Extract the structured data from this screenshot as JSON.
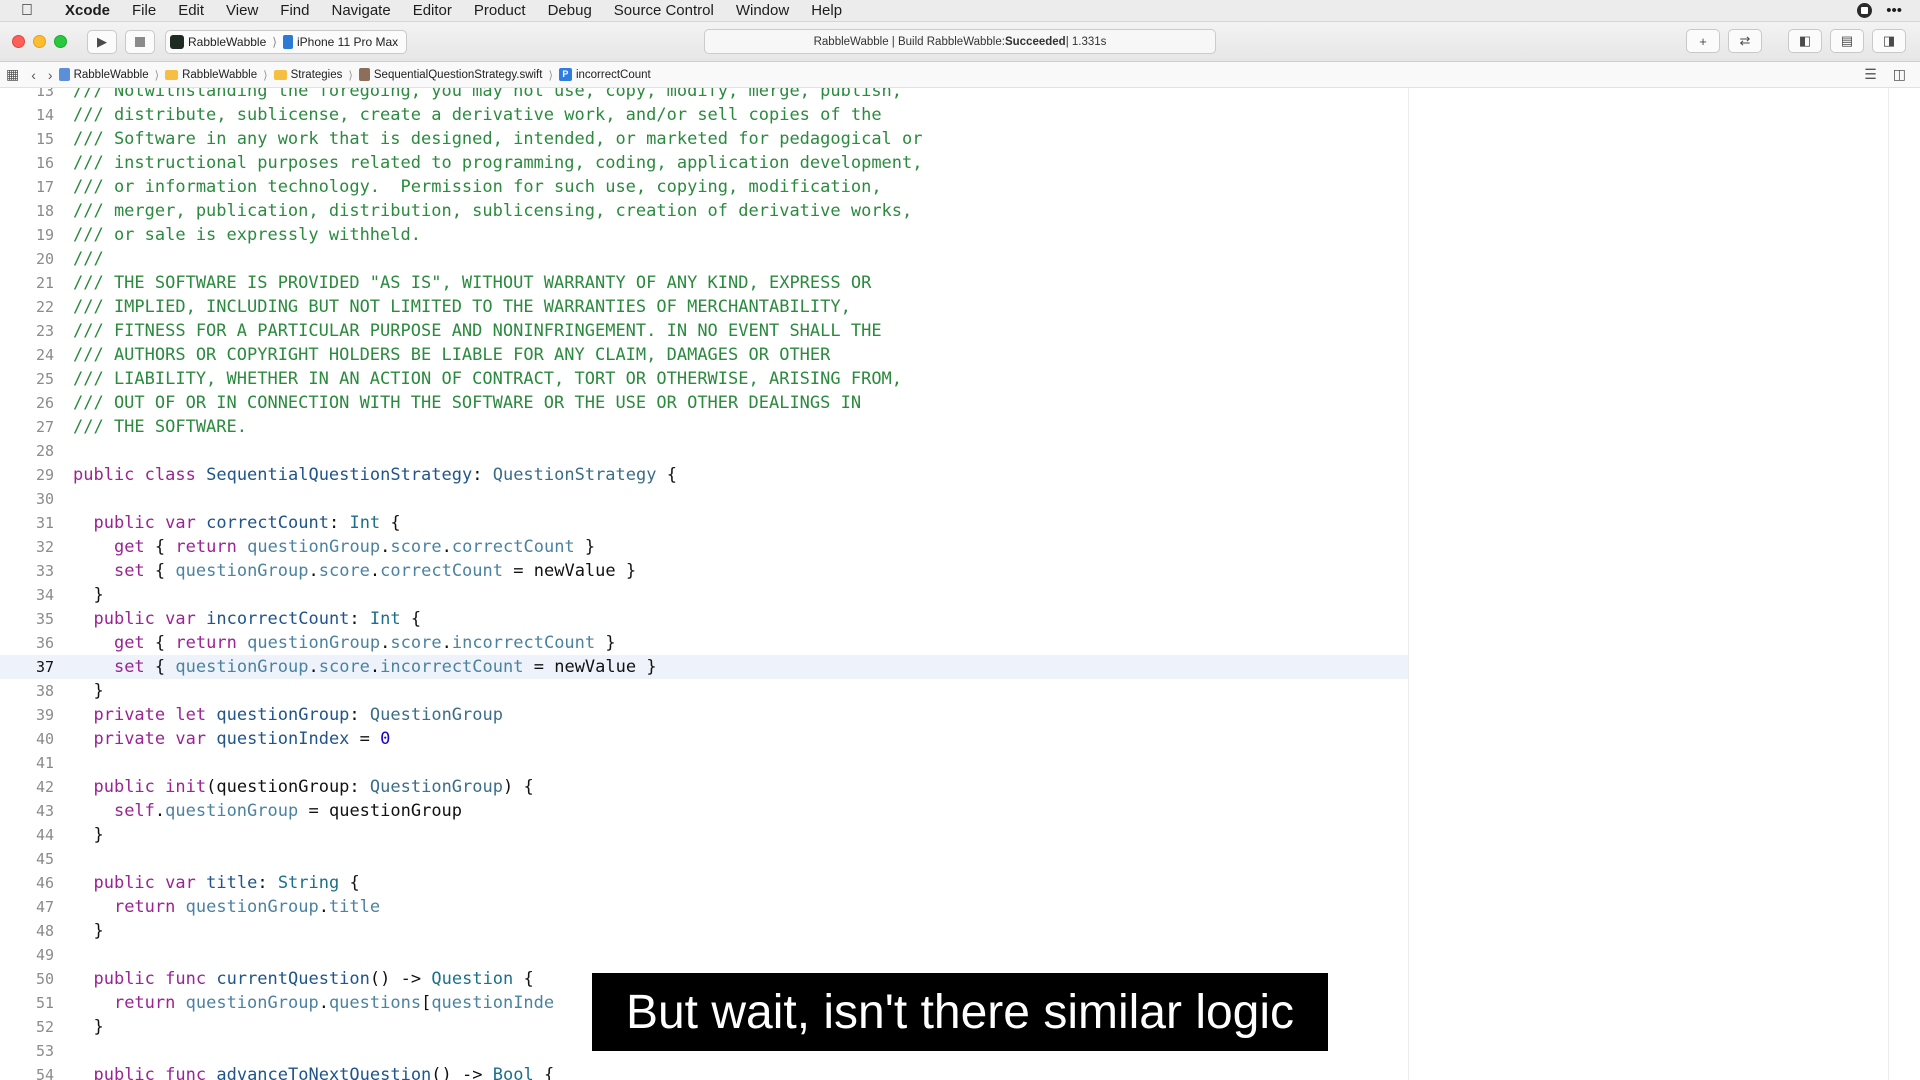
{
  "menubar": {
    "app_name": "Xcode",
    "items": [
      "File",
      "Edit",
      "View",
      "Find",
      "Navigate",
      "Editor",
      "Product",
      "Debug",
      "Source Control",
      "Window",
      "Help"
    ]
  },
  "toolbar": {
    "scheme": "RabbleWabble",
    "device": "iPhone 11 Pro Max",
    "activity_prefix": "RabbleWabble | Build RabbleWabble: ",
    "activity_status": "Succeeded",
    "activity_suffix": " | 1.331s"
  },
  "jumpbar": {
    "crumbs": [
      "RabbleWabble",
      "RabbleWabble",
      "Strategies",
      "SequentialQuestionStrategy.swift",
      "incorrectCount"
    ]
  },
  "editor": {
    "current_line": "37",
    "lines": [
      {
        "n": "13",
        "text": "/// Notwithstanding the foregoing, you may not use, copy, modify, merge, publish,"
      },
      {
        "n": "14",
        "text": "/// distribute, sublicense, create a derivative work, and/or sell copies of the"
      },
      {
        "n": "15",
        "text": "/// Software in any work that is designed, intended, or marketed for pedagogical or"
      },
      {
        "n": "16",
        "text": "/// instructional purposes related to programming, coding, application development,"
      },
      {
        "n": "17",
        "text": "/// or information technology.  Permission for such use, copying, modification,"
      },
      {
        "n": "18",
        "text": "/// merger, publication, distribution, sublicensing, creation of derivative works,"
      },
      {
        "n": "19",
        "text": "/// or sale is expressly withheld."
      },
      {
        "n": "20",
        "text": "///"
      },
      {
        "n": "21",
        "text": "/// THE SOFTWARE IS PROVIDED \"AS IS\", WITHOUT WARRANTY OF ANY KIND, EXPRESS OR"
      },
      {
        "n": "22",
        "text": "/// IMPLIED, INCLUDING BUT NOT LIMITED TO THE WARRANTIES OF MERCHANTABILITY,"
      },
      {
        "n": "23",
        "text": "/// FITNESS FOR A PARTICULAR PURPOSE AND NONINFRINGEMENT. IN NO EVENT SHALL THE"
      },
      {
        "n": "24",
        "text": "/// AUTHORS OR COPYRIGHT HOLDERS BE LIABLE FOR ANY CLAIM, DAMAGES OR OTHER"
      },
      {
        "n": "25",
        "text": "/// LIABILITY, WHETHER IN AN ACTION OF CONTRACT, TORT OR OTHERWISE, ARISING FROM,"
      },
      {
        "n": "26",
        "text": "/// OUT OF OR IN CONNECTION WITH THE SOFTWARE OR THE USE OR OTHER DEALINGS IN"
      },
      {
        "n": "27",
        "text": "/// THE SOFTWARE."
      },
      {
        "n": "28",
        "text": ""
      },
      {
        "n": "29",
        "text": "public class SequentialQuestionStrategy: QuestionStrategy {"
      },
      {
        "n": "30",
        "text": ""
      },
      {
        "n": "31",
        "text": "  public var correctCount: Int {"
      },
      {
        "n": "32",
        "text": "    get { return questionGroup.score.correctCount }"
      },
      {
        "n": "33",
        "text": "    set { questionGroup.score.correctCount = newValue }"
      },
      {
        "n": "34",
        "text": "  }"
      },
      {
        "n": "35",
        "text": "  public var incorrectCount: Int {"
      },
      {
        "n": "36",
        "text": "    get { return questionGroup.score.incorrectCount }"
      },
      {
        "n": "37",
        "text": "    set { questionGroup.score.incorrectCount = newValue }"
      },
      {
        "n": "38",
        "text": "  }"
      },
      {
        "n": "39",
        "text": "  private let questionGroup: QuestionGroup"
      },
      {
        "n": "40",
        "text": "  private var questionIndex = 0"
      },
      {
        "n": "41",
        "text": ""
      },
      {
        "n": "42",
        "text": "  public init(questionGroup: QuestionGroup) {"
      },
      {
        "n": "43",
        "text": "    self.questionGroup = questionGroup"
      },
      {
        "n": "44",
        "text": "  }"
      },
      {
        "n": "45",
        "text": ""
      },
      {
        "n": "46",
        "text": "  public var title: String {"
      },
      {
        "n": "47",
        "text": "    return questionGroup.title"
      },
      {
        "n": "48",
        "text": "  }"
      },
      {
        "n": "49",
        "text": ""
      },
      {
        "n": "50",
        "text": "  public func currentQuestion() -> Question {"
      },
      {
        "n": "51",
        "text": "    return questionGroup.questions[questionInde"
      },
      {
        "n": "52",
        "text": "  }"
      },
      {
        "n": "53",
        "text": ""
      },
      {
        "n": "54",
        "text": "  public func advanceToNextQuestion() -> Bool {"
      }
    ]
  },
  "caption": "But wait, isn't there similar logic"
}
